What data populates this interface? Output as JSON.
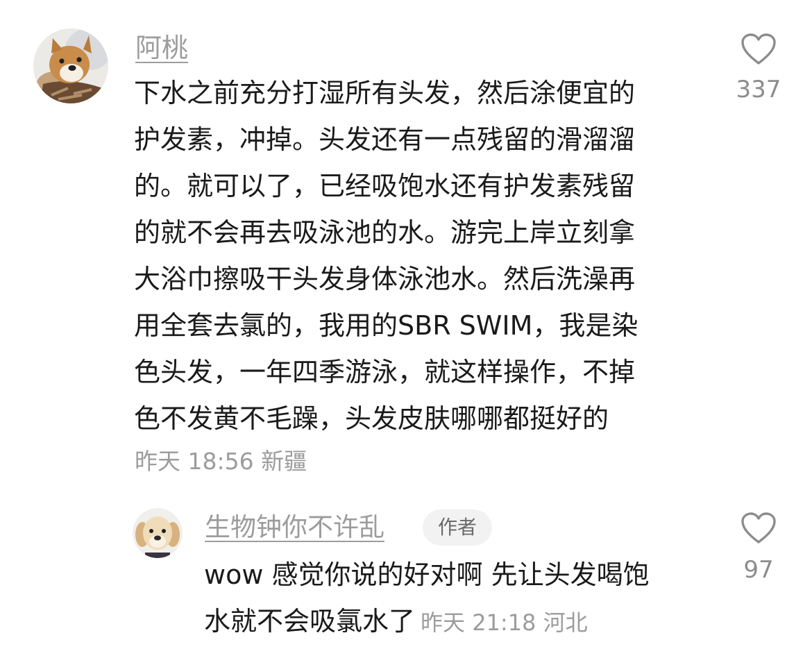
{
  "comments": [
    {
      "avatar_icon": "shiba-dog-avatar",
      "username": "阿桃",
      "text_lines": [
        "下水之前充分打湿所有头发，然后涂便宜的",
        "护发素，冲掉。头发还有一点残留的滑溜溜",
        "的。就可以了，已经吸饱水还有护发素残留",
        "的就不会再去吸泳池的水。游完上岸立刻拿",
        "大浴巾擦吸干头发身体泳池水。然后洗澡再",
        "用全套去氯的，我用的SBR SWIM，我是染",
        "色头发，一年四季游泳，就这样操作，不掉",
        "色不发黄不毛躁，头发皮肤哪哪都挺好的"
      ],
      "meta": "昨天 18:56 新疆",
      "like_icon": "heart-outline-icon",
      "like_count": "337"
    }
  ],
  "reply": {
    "avatar_icon": "golden-retriever-puppy-avatar",
    "username": "生物钟你不许乱",
    "badge": "作者",
    "text_lines": [
      "wow 感觉你说的好对啊 先让头发喝饱",
      "水就不会吸氯水了"
    ],
    "meta": "昨天 21:18 河北",
    "like_icon": "heart-outline-icon",
    "like_count": "97"
  },
  "colors": {
    "text": "#1a1a1a",
    "muted": "#9c9c9c",
    "badge_bg": "#f2f2f2",
    "icon": "#8c8c8c"
  }
}
